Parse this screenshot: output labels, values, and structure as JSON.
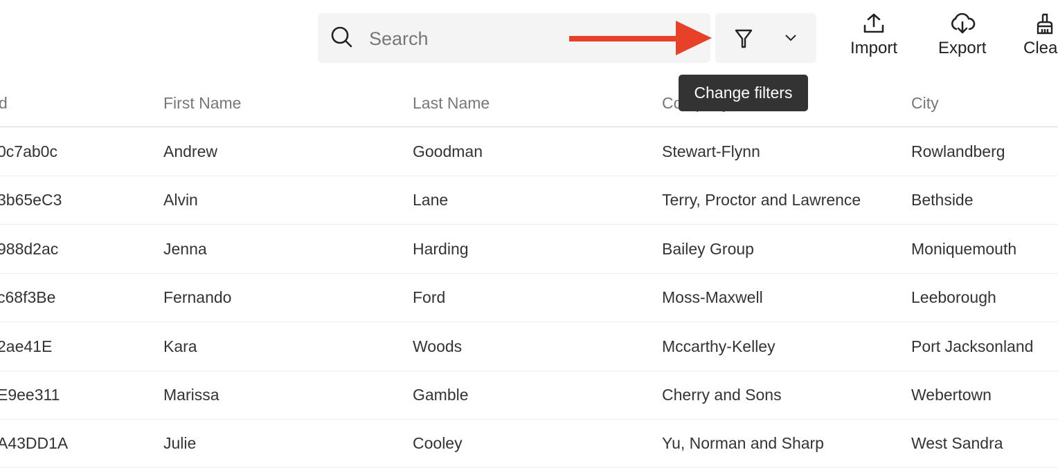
{
  "toolbar": {
    "search_placeholder": "Search",
    "filter_tooltip": "Change filters",
    "actions": [
      {
        "label": "Import",
        "icon": "upload-icon"
      },
      {
        "label": "Export",
        "icon": "cloud-download-icon"
      },
      {
        "label": "Clea",
        "icon": "broom-icon"
      }
    ],
    "annotation_arrow_color": "#e8412a"
  },
  "table": {
    "columns": [
      "d",
      "First Name",
      "Last Name",
      "Company",
      "City"
    ],
    "rows": [
      [
        "0c7ab0c",
        "Andrew",
        "Goodman",
        "Stewart-Flynn",
        "Rowlandberg"
      ],
      [
        "3b65eC3",
        "Alvin",
        "Lane",
        "Terry, Proctor and Lawrence",
        "Bethside"
      ],
      [
        "988d2ac",
        "Jenna",
        "Harding",
        "Bailey Group",
        "Moniquemouth"
      ],
      [
        "c68f3Be",
        "Fernando",
        "Ford",
        "Moss-Maxwell",
        "Leeborough"
      ],
      [
        "2ae41E",
        "Kara",
        "Woods",
        "Mccarthy-Kelley",
        "Port Jacksonland"
      ],
      [
        "E9ee311",
        "Marissa",
        "Gamble",
        "Cherry and Sons",
        "Webertown"
      ],
      [
        "A43DD1A",
        "Julie",
        "Cooley",
        "Yu, Norman and Sharp",
        "West Sandra"
      ]
    ]
  }
}
